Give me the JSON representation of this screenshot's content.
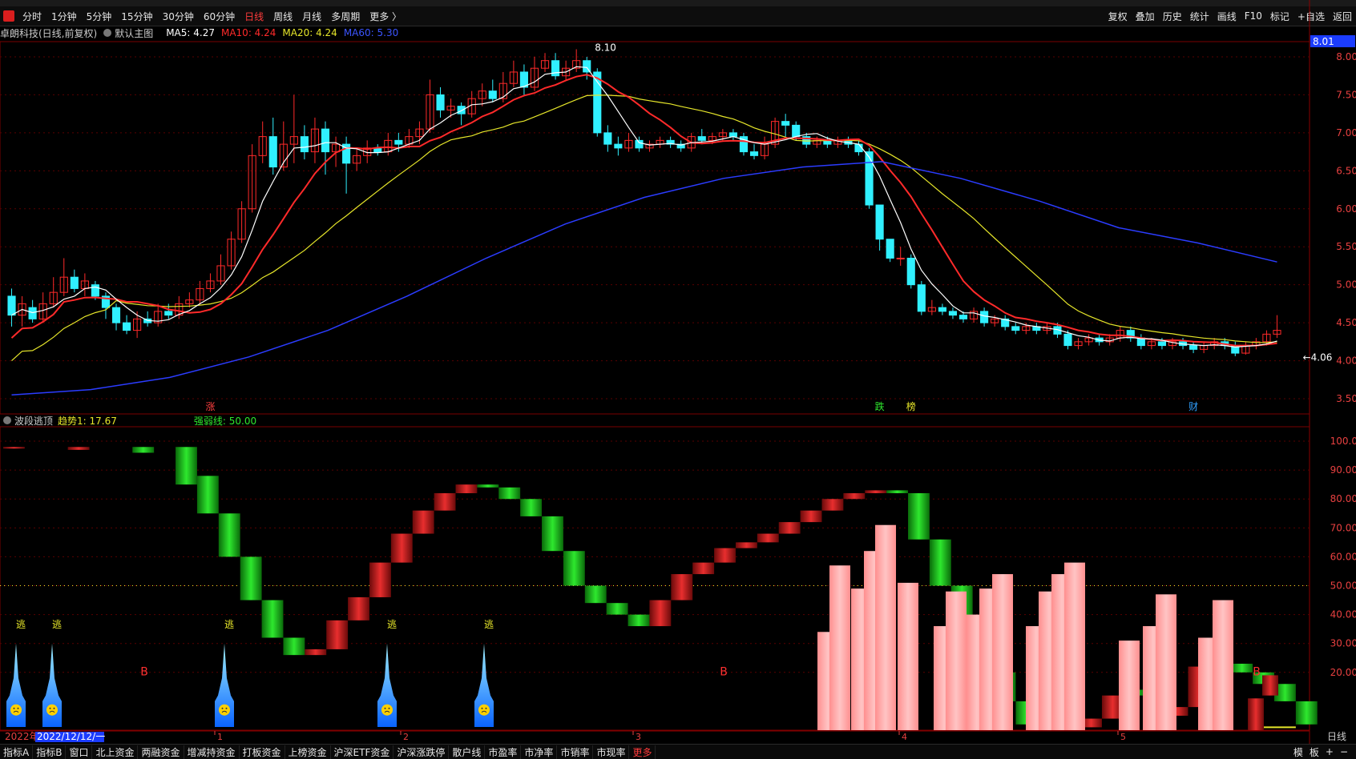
{
  "toolbar": {
    "periods": [
      "分时",
      "1分钟",
      "5分钟",
      "15分钟",
      "30分钟",
      "60分钟",
      "日线",
      "周线",
      "月线",
      "多周期",
      "更多 〉"
    ],
    "active_period": "日线",
    "right_tools": [
      "复权",
      "叠加",
      "历史",
      "统计",
      "画线",
      "F10",
      "标记",
      "+自选",
      "返回"
    ]
  },
  "info": {
    "stock": "卓朗科技(日线,前复权)",
    "main_chart": "默认主图",
    "ma5": "MA5: 4.27",
    "ma10": "MA10: 4.24",
    "ma20": "MA20: 4.24",
    "ma60": "MA60: 5.30",
    "price_tag": "8.01"
  },
  "colors": {
    "ma5": "#ffffff",
    "ma10": "#ff2a2a",
    "ma20": "#e6e62a",
    "ma60": "#2b3cff",
    "up": "#ff2a2a",
    "down": "#30f0ff"
  },
  "price_axis": {
    "labels": [
      "8.00",
      "7.50",
      "7.00",
      "6.50",
      "6.00",
      "5.50",
      "5.00",
      "4.50",
      "4.00",
      "3.50"
    ]
  },
  "markers": {
    "high_label": "8.10",
    "low_label": "4.06",
    "events": [
      "涨",
      "跌",
      "榜",
      "财"
    ]
  },
  "indicator": {
    "name": "波段逃顶",
    "trend": "趋势1: 17.67",
    "strong": "强弱线: 50.00",
    "axis": [
      "100.0",
      "90.00",
      "80.00",
      "70.00",
      "60.00",
      "50.00",
      "40.00",
      "30.00",
      "20.00"
    ],
    "escape_label": "逃",
    "buy_label": "B"
  },
  "date_axis": {
    "start_year": "2022年",
    "cursor_date": "2022/12/12/一",
    "months": [
      "1",
      "2",
      "3",
      "4",
      "5"
    ],
    "period": "日线"
  },
  "bottom_tabs": [
    "指标A",
    "指标B",
    "窗口",
    "北上资金",
    "两融资金",
    "增减持资金",
    "打板资金",
    "上榜资金",
    "沪深ETF资金",
    "沪深涨跌停",
    "散户线",
    "市盈率",
    "市净率",
    "市销率",
    "市现率",
    "更多"
  ],
  "bottom_right": [
    "模",
    "板",
    "+",
    "−"
  ]
}
